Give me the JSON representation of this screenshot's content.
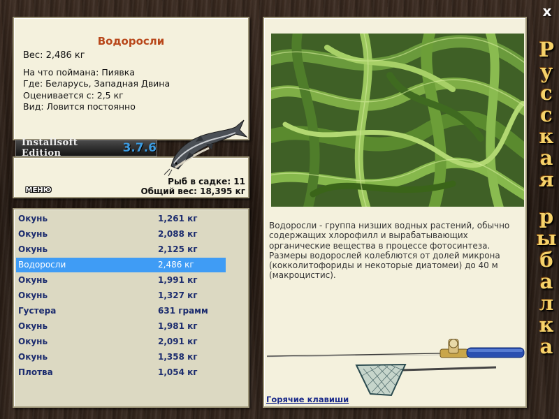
{
  "window": {
    "close_label": "x",
    "side_title": [
      "Р",
      "у",
      "с",
      "с",
      "к",
      "а",
      "я",
      " ",
      "р",
      "ы",
      "б",
      "а",
      "л",
      "к",
      "а"
    ]
  },
  "catch": {
    "name": "Водоросли",
    "weight": "Вес: 2,486 кг",
    "bait": "На что поймана: Пиявка",
    "place": "Где: Беларусь, Западная Двина",
    "value_from": "Оценивается с: 2,5 кг",
    "kind": "Вид: Ловится постоянно"
  },
  "edition": {
    "text": "Installsoft Edition",
    "version": "3.7.6"
  },
  "menu_label": "МЕНЮ",
  "stats": {
    "fish_count": "Рыб в садке: 11",
    "total_weight": "Общий вес: 18,395 кг"
  },
  "fish_list": [
    {
      "name": "Окунь",
      "weight": "1,261 кг"
    },
    {
      "name": "Окунь",
      "weight": "2,088 кг"
    },
    {
      "name": "Окунь",
      "weight": "2,125 кг"
    },
    {
      "name": "Водоросли",
      "weight": "2,486 кг"
    },
    {
      "name": "Окунь",
      "weight": "1,991 кг"
    },
    {
      "name": "Окунь",
      "weight": "1,327 кг"
    },
    {
      "name": "Густера",
      "weight": "631 грамм"
    },
    {
      "name": "Окунь",
      "weight": "1,981 кг"
    },
    {
      "name": "Окунь",
      "weight": "2,091 кг"
    },
    {
      "name": "Окунь",
      "weight": "1,358 кг"
    },
    {
      "name": "Плотва",
      "weight": "1,054 кг"
    }
  ],
  "selected_index": 3,
  "description": "Водоросли - группа низших водных растений, обычно содержащих хлорофилл и вырабатывающих органические вещества в процессе фотосинтеза. Размеры водорослей колеблются от долей микрона (кокколитофориды и некоторые диатомеи) до 40 м (макроцистис).",
  "hotkeys_label": "Горячие клавиши",
  "colors": {
    "accent_title": "#b8471a",
    "list_text": "#1c2c6e",
    "selection": "#3f9cf5",
    "side_title": "#f5d26a"
  }
}
